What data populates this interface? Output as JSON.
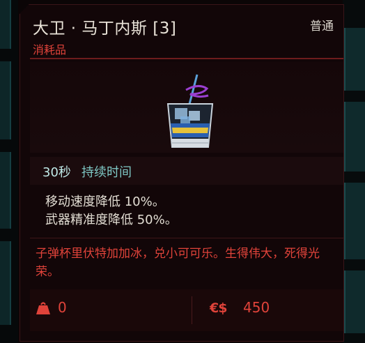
{
  "item": {
    "name": "大卫 · 马丁内斯 [3]",
    "rarity": "普通",
    "category": "消耗品"
  },
  "duration": {
    "value": "30秒",
    "label": "持续时间"
  },
  "effects": [
    "移动速度降低 10%。",
    "武器精准度降低 50%。"
  ],
  "flavor_text": "子弹杯里伏特加加冰，兑小可可乐。生得伟大，死得光荣。",
  "footer": {
    "weight": "0",
    "currency_symbol": "€$",
    "price": "450"
  },
  "icons": {
    "weight": "weight-icon",
    "item": "cocktail-glass-icon"
  },
  "colors": {
    "accent_red": "#e0433a",
    "duration_teal": "#7ec7c4",
    "title": "#e9e3d8",
    "panel_bg": "#120608"
  }
}
